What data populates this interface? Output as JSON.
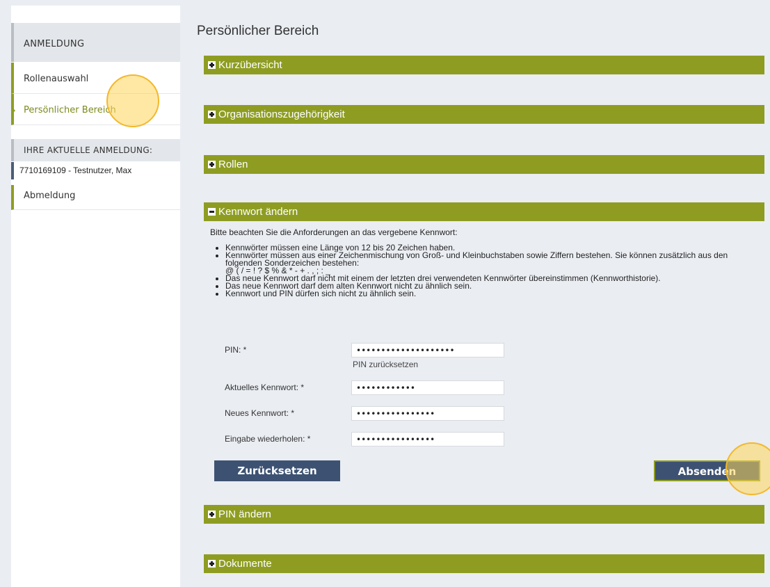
{
  "sidebar": {
    "section_login": "ANMELDUNG",
    "items": [
      {
        "label": "Rollenauswahl"
      },
      {
        "label": "Persönlicher Bereich"
      }
    ],
    "section_current": "IHRE AKTUELLE ANMELDUNG:",
    "current_user": "7710169109 - Testnutzer, Max",
    "logout": "Abmeldung"
  },
  "main": {
    "title": "Persönlicher Bereich",
    "panels": [
      {
        "label": "Kurzübersicht",
        "expanded": false
      },
      {
        "label": "Organisationszugehörigkeit",
        "expanded": false
      },
      {
        "label": "Rollen",
        "expanded": false
      },
      {
        "label": "Kennwort ändern",
        "expanded": true
      },
      {
        "label": "PIN ändern",
        "expanded": false
      },
      {
        "label": "Dokumente",
        "expanded": false
      }
    ],
    "password": {
      "intro": "Bitte beachten Sie die Anforderungen an das vergebene Kennwort:",
      "rules": [
        "Kennwörter müssen eine Länge von 12 bis 20 Zeichen haben.",
        "Kennwörter müssen aus einer Zeichenmischung von Groß- und Kleinbuchstaben sowie Ziffern bestehen. Sie können zusätzlich aus den folgenden Sonderzeichen bestehen:",
        "@ ( / = ! ? $ % & * - + . , ; : _",
        "Das neue Kennwort darf nicht mit einem der letzten drei verwendeten Kennwörter übereinstimmen (Kennworthistorie).",
        "Das neue Kennwort darf dem alten Kennwort nicht zu ähnlich sein.",
        "Kennwort und PIN dürfen sich nicht zu ähnlich sein."
      ],
      "fields": [
        {
          "label": "PIN: *",
          "value": "••••••••••••••••••••"
        },
        {
          "label": "Aktuelles Kennwort: *",
          "value": "••••••••••••"
        },
        {
          "label": "Neues Kennwort: *",
          "value": "••••••••••••••••"
        },
        {
          "label": "Eingabe wiederholen: *",
          "value": "••••••••••••••••"
        }
      ],
      "pin_reset_link": "PIN zurücksetzen",
      "reset_button": "Zurücksetzen",
      "submit_button": "Absenden"
    }
  },
  "colors": {
    "accent_green": "#8e9d22",
    "button_blue": "#3d5272",
    "highlight": "#fdd65a"
  }
}
